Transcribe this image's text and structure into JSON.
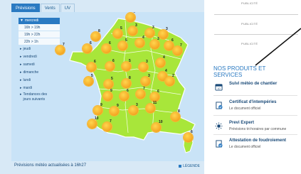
{
  "tabs": [
    {
      "label": "Prévisions",
      "active": true
    },
    {
      "label": "Vents",
      "active": false
    },
    {
      "label": "UV",
      "active": false
    }
  ],
  "day_list": {
    "selected_day": "mercredi",
    "hours": [
      "16h > 19h",
      "19h > 22h",
      "22h > 1h"
    ],
    "other_days": [
      "jeudi",
      "vendredi",
      "samedi",
      "dimanche",
      "lundi",
      "mardi"
    ],
    "trends_line1": "Tendances des",
    "trends_line2": "jours suivants"
  },
  "map": {
    "land_color": "#a8e63a",
    "sea_color": "#c9e3f7",
    "weather_icon": "sun-icon",
    "values": [
      "4",
      "8",
      "5",
      "3",
      "3",
      "3",
      "7",
      "6",
      "6",
      "5",
      "4",
      "3",
      "6",
      "7",
      "6",
      "6",
      "5",
      "3",
      "4",
      "5",
      "5",
      "8",
      "3",
      "4",
      "2",
      "9",
      "6",
      "7",
      "6",
      "9",
      "9",
      "3",
      "11",
      "10",
      "7",
      "10",
      "8",
      "6"
    ]
  },
  "footer": {
    "updated_text": "Prévisions météo actualisées à 16h27",
    "legend_link": "LÉGENDE"
  },
  "ads": [
    "PUBLICITÉ",
    "PUBLICITÉ",
    "PUBLICITÉ"
  ],
  "products": {
    "title_line1": "NOS PRODUITS ET",
    "title_line2": "SERVICES",
    "items": [
      {
        "name": "Suivi météo de chantier",
        "desc": "",
        "icon": "calendar-icon"
      },
      {
        "name": "Certificat d'intempéries",
        "desc": "Le document officiel",
        "icon": "certificate-check-icon"
      },
      {
        "name": "Previ Expert",
        "desc": "Prévisions tri-horaires par commune",
        "icon": "sun-expert-icon"
      },
      {
        "name": "Attestation de foudroiement",
        "desc": "Le document officiel",
        "icon": "lightning-certificate-icon"
      }
    ]
  }
}
